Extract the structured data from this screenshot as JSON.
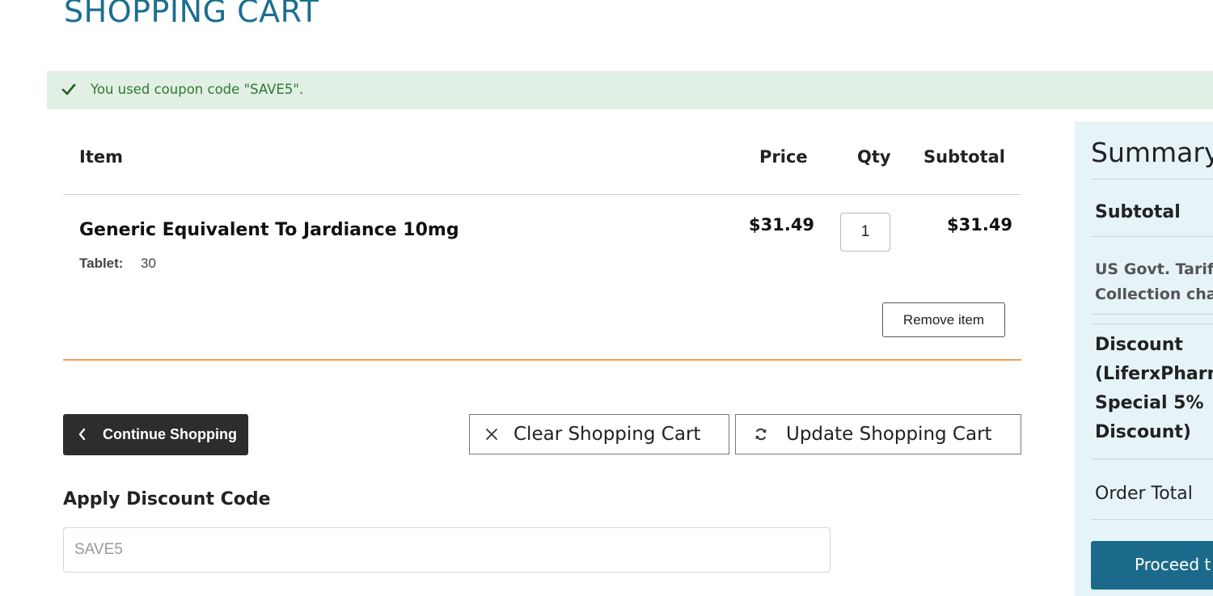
{
  "page": {
    "title": "SHOPPING CART"
  },
  "notice": {
    "message": "You used coupon code \"SAVE5\"."
  },
  "cart": {
    "headers": {
      "item": "Item",
      "price": "Price",
      "qty": "Qty",
      "subtotal": "Subtotal"
    },
    "items": [
      {
        "name": "Generic Equivalent To Jardiance 10mg",
        "option_label": "Tablet:",
        "option_value": "30",
        "price": "$31.49",
        "qty": "1",
        "subtotal": "$31.49",
        "remove_label": "Remove item"
      }
    ]
  },
  "actions": {
    "continue_label": "Continue Shopping",
    "clear_label": "Clear Shopping Cart",
    "update_label": "Update Shopping Cart"
  },
  "discount": {
    "title": "Apply Discount Code",
    "value": "SAVE5"
  },
  "summary": {
    "title": "Summary",
    "subtotal_label": "Subtotal",
    "tariff_line1": "US Govt. Tariff",
    "tariff_line2": "Collection cha",
    "discount_lines": [
      "Discount",
      "(LiferxPharm",
      "Special 5%",
      "Discount)"
    ],
    "order_total_label": "Order Total",
    "proceed_label": "Proceed t"
  },
  "colors": {
    "title": "#1b6f8f",
    "success_bg": "#e1efe5",
    "success_text": "#2f7a2f",
    "accent_rule": "#f1a04e",
    "summary_bg": "#e6f4f8",
    "primary_button": "#1b6a8b",
    "dark_button": "#2d2d2d"
  }
}
